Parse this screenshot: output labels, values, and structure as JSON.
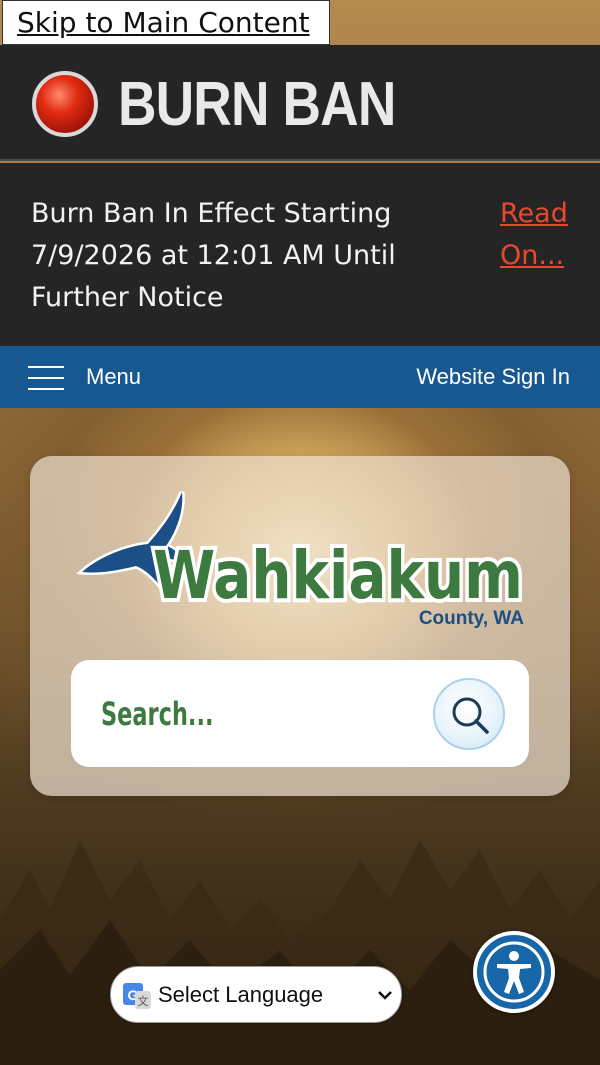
{
  "skip_link": "Skip to Main Content",
  "burn_ban": {
    "title": "BURN BAN",
    "alert_text": "Burn Ban In Effect Starting 7/9/2026 at 12:01 AM Until Further Notice",
    "read_more": "Read On...",
    "status_color": "#e12b12"
  },
  "nav": {
    "menu_label": "Menu",
    "sign_in": "Website Sign In",
    "bar_color": "#175890"
  },
  "logo": {
    "name": "Wahkiakum",
    "sub": "County, WA",
    "icon": "eagle-icon"
  },
  "search": {
    "placeholder": "Search...",
    "icon": "search-icon"
  },
  "language": {
    "label": "Select Language",
    "icon": "google-translate-icon"
  },
  "accessibility": {
    "icon": "accessibility-icon"
  },
  "colors": {
    "brand_green": "#3d7a3f",
    "brand_blue": "#1c4f85",
    "alert_link": "#e8492e"
  }
}
